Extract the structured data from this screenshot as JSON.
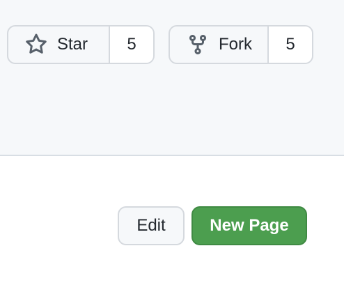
{
  "repo_actions": {
    "star": {
      "label": "Star",
      "count": "5",
      "icon": "star-icon"
    },
    "fork": {
      "label": "Fork",
      "count": "5",
      "icon": "repo-forked-icon"
    }
  },
  "wiki_actions": {
    "edit_label": "Edit",
    "new_page_label": "New Page"
  },
  "colors": {
    "header_bg": "#f6f8fa",
    "border": "#d5d9de",
    "primary_green": "#4c9e4f",
    "text": "#24292f"
  }
}
